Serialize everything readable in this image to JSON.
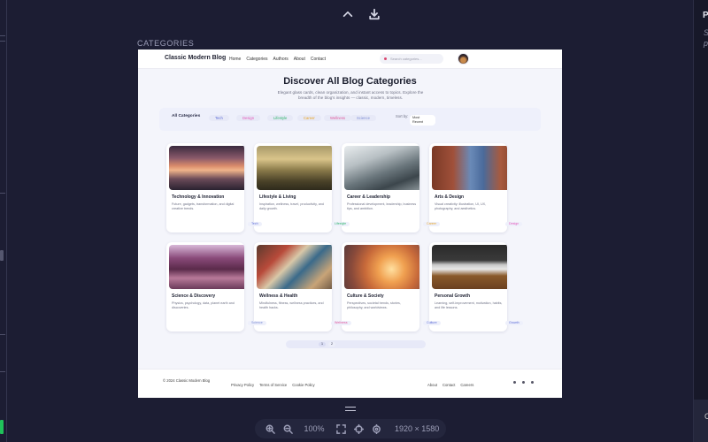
{
  "toolbar": {
    "collapse_icon": "chevron-up-icon",
    "download_icon": "download-icon"
  },
  "section_label": "CATEGORIES",
  "right_panel": {
    "title": "P",
    "subtitle_line1": "S",
    "subtitle_line2": "p",
    "bottom_label": "C"
  },
  "zoom": {
    "level": "100%",
    "dimensions": "1920 × 1580"
  },
  "page": {
    "brand": "Classic Modern Blog",
    "nav": [
      "Home",
      "Categories",
      "Authors",
      "About",
      "Contact"
    ],
    "search_placeholder": "Search categories...",
    "hero_title": "Discover All Blog Categories",
    "hero_subtitle": "Elegant glass cards, clean organization, and instant access to topics. Explore the breadth of the blog's insights — classic, modern, timeless.",
    "filter_all": "All Categories",
    "filters": [
      {
        "label": "Tech",
        "color": "#5b6bd6"
      },
      {
        "label": "Design",
        "color": "#e455b8"
      },
      {
        "label": "Lifestyle",
        "color": "#2db56a"
      },
      {
        "label": "Career",
        "color": "#e8a21f"
      },
      {
        "label": "Wellness",
        "color": "#e0559a"
      },
      {
        "label": "Science",
        "color": "#7b8bd4"
      }
    ],
    "sort_label": "Sort by:",
    "sort_value_line1": "Most",
    "sort_value_line2": "Recent",
    "cards": [
      {
        "title": "Technology & Innovation",
        "desc": "Future, gadgets, transformation, and digital creative trends.",
        "tag": "",
        "tag_color": "#5b6bd6"
      },
      {
        "title": "Lifestyle & Living",
        "desc": "Inspiration, wellness, travel, productivity, and daily growth.",
        "tag": "Tech",
        "tag_color": "#5b6bd6"
      },
      {
        "title": "Career & Leadership",
        "desc": "Professional development, leadership, business tips, and ambition.",
        "tag": "Lifestyle",
        "tag_color": "#2db56a"
      },
      {
        "title": "Arts & Design",
        "desc": "Visual creativity: illustration, UI, UX, photography, and aesthetics.",
        "tag": "Career",
        "tag_color": "#e8a21f"
      },
      {
        "title": "Science & Discovery",
        "desc": "Physics, psychology, data, planet earth and discoveries.",
        "tag": "",
        "tag_color": "#7b8bd4"
      },
      {
        "title": "Wellness & Health",
        "desc": "Mindfulness, fitness, wellness practices, and health hacks.",
        "tag": "Science",
        "tag_color": "#7b8bd4"
      },
      {
        "title": "Culture & Society",
        "desc": "Perspectives, societal trends, stories, philosophy, and worldviews.",
        "tag": "Wellness",
        "tag_color": "#e0559a"
      },
      {
        "title": "Personal Growth",
        "desc": "Learning, self-improvement, motivation, habits, and life lessons.",
        "tag": "Culture",
        "tag_color": "#5b6bd6"
      }
    ],
    "extra_tags": [
      {
        "label": "Design",
        "color": "#e455b8"
      },
      {
        "label": "Growth",
        "color": "#5b6bd6"
      }
    ],
    "pages": [
      "1",
      "2"
    ],
    "footer": {
      "copyright": "© 2024 Classic Modern Blog",
      "legal": [
        "Privacy Policy",
        "Terms of Service",
        "Cookie Policy"
      ],
      "links": [
        "About",
        "Contact",
        "Careers"
      ]
    }
  }
}
